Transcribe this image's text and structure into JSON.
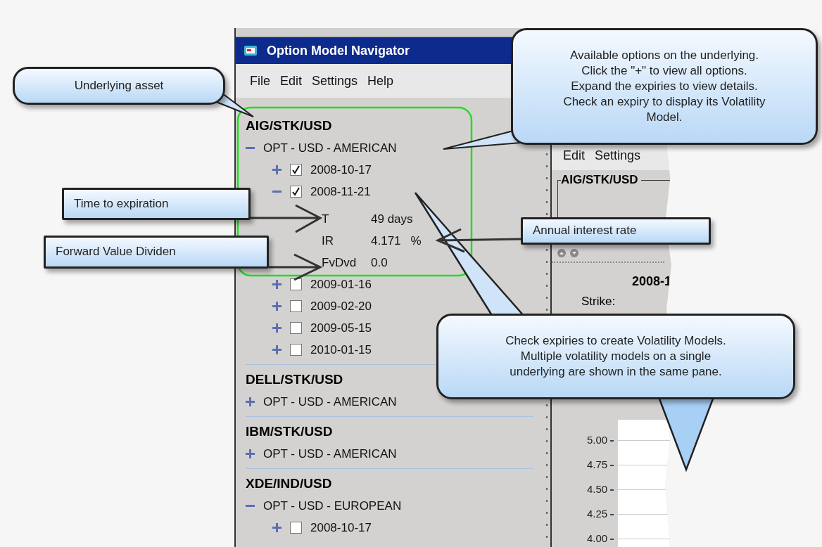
{
  "main_window": {
    "title": "Option Model Navigator",
    "menu": [
      "File",
      "Edit",
      "Settings",
      "Help"
    ],
    "underlyings": [
      {
        "name": "AIG/STK/USD",
        "contracts": [
          {
            "label": "OPT - USD - AMERICAN",
            "expanded": true,
            "expiries": [
              {
                "date": "2008-10-17",
                "checked": true,
                "expanded": false
              },
              {
                "date": "2008-11-21",
                "checked": true,
                "expanded": true,
                "details": [
                  {
                    "label": "T",
                    "value": "49 days"
                  },
                  {
                    "label": "IR",
                    "value": "4.171",
                    "unit": "%"
                  },
                  {
                    "label": "FvDvd",
                    "value": "0.0"
                  }
                ]
              },
              {
                "date": "2009-01-16",
                "checked": false,
                "expanded": false
              },
              {
                "date": "2009-02-20",
                "checked": false,
                "expanded": false
              },
              {
                "date": "2009-05-15",
                "checked": false,
                "expanded": false
              },
              {
                "date": "2010-01-15",
                "checked": false,
                "expanded": false
              }
            ]
          }
        ]
      },
      {
        "name": "DELL/STK/USD",
        "contracts": [
          {
            "label": "OPT - USD - AMERICAN",
            "expanded": false
          }
        ]
      },
      {
        "name": "IBM/STK/USD",
        "contracts": [
          {
            "label": "OPT - USD - AMERICAN",
            "expanded": false
          }
        ]
      },
      {
        "name": "XDE/IND/USD",
        "contracts": [
          {
            "label": "OPT - USD - EUROPEAN",
            "expanded": true,
            "expiries": [
              {
                "date": "2008-10-17",
                "checked": false,
                "expanded": false
              }
            ]
          }
        ]
      }
    ]
  },
  "right_window": {
    "menu": [
      "Edit",
      "Settings"
    ],
    "group_title": "AIG/STK/USD",
    "expiry_heading": "2008-1",
    "strike_label": "Strike:",
    "y_ticks": [
      "5.00",
      "4.75",
      "4.50",
      "4.25",
      "4.00"
    ]
  },
  "callouts": [
    {
      "kind": "bubble",
      "lines": [
        "Underlying asset"
      ]
    },
    {
      "kind": "bubble",
      "lines": [
        "Available options on the underlying.",
        "Click the \"+\" to view all options.",
        "Expand the expiries to view details.",
        "Check an expiry to display its Volatility",
        "Model."
      ]
    },
    {
      "kind": "label",
      "lines": [
        "Time to expiration"
      ]
    },
    {
      "kind": "label",
      "lines": [
        "Forward Value Dividen"
      ]
    },
    {
      "kind": "label",
      "lines": [
        "Annual interest rate"
      ]
    },
    {
      "kind": "bubble",
      "lines": [
        "Check expiries to create Volatility Models.",
        "Multiple volatility models on a single",
        "underlying are shown in the same pane."
      ]
    }
  ]
}
